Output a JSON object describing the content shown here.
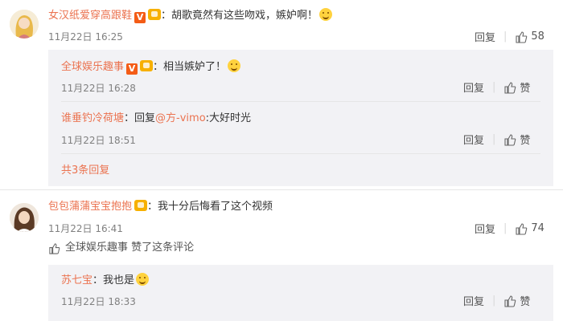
{
  "comments": [
    {
      "user": "女汉纸爱穿高跟鞋",
      "text": "：胡歌竟然有这些吻戏，嫉妒啊！",
      "time": "11月22日 16:25",
      "reply_label": "回复",
      "like_count": "58",
      "replies": [
        {
          "user": "全球娱乐趣事",
          "text": "：相当嫉妒了！",
          "time": "11月22日 16:28",
          "reply_label": "回复",
          "like_label": "赞"
        },
        {
          "user": "谁垂钓冷荷塘",
          "text_prefix": "：回复",
          "mention": "@方-vimo",
          "text": ":大好时光",
          "time": "11月22日 18:51",
          "reply_label": "回复",
          "like_label": "赞"
        }
      ],
      "more_replies": "共3条回复"
    },
    {
      "user": "包包蒲蒲宝宝抱抱",
      "text": "：我十分后悔看了这个视频",
      "time": "11月22日 16:41",
      "reply_label": "回复",
      "like_count": "74",
      "liked_by": "全球娱乐趣事 赞了这条评论",
      "replies": [
        {
          "user": "苏七宝",
          "text": "：我也是",
          "time": "11月22日 18:33",
          "reply_label": "回复",
          "like_label": "赞"
        }
      ]
    }
  ],
  "colors": {
    "username": "#eb7350",
    "nested_bg": "#f2f2f5",
    "timestamp": "#808080"
  },
  "icons": {
    "like": "thumbs-up-icon",
    "verified": "v-badge-icon",
    "vip": "vip-badge-icon"
  }
}
